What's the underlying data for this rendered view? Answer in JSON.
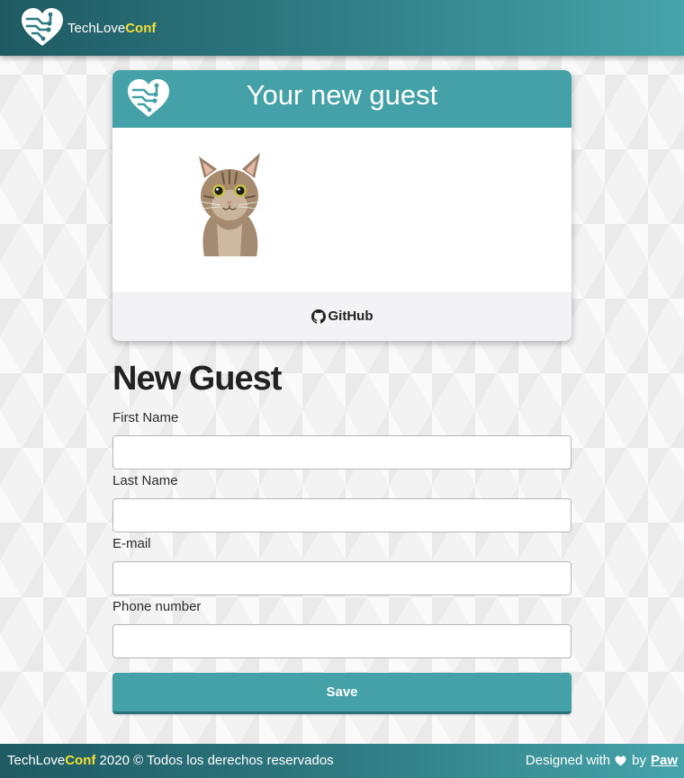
{
  "header": {
    "brand_primary": "TechLove",
    "brand_accent": "Conf",
    "logo_icon": "heart-circuit-logo"
  },
  "badge": {
    "title": "Your new guest",
    "avatar_icon": "cat-photo",
    "github_label": "GitHub",
    "github_icon": "github-icon"
  },
  "form": {
    "title": "New Guest",
    "fields": [
      {
        "label": "First Name",
        "value": "",
        "placeholder": ""
      },
      {
        "label": "Last Name",
        "value": "",
        "placeholder": ""
      },
      {
        "label": "E-mail",
        "value": "",
        "placeholder": ""
      },
      {
        "label": "Phone number",
        "value": "",
        "placeholder": ""
      }
    ],
    "save_label": "Save"
  },
  "footer": {
    "brand_primary": "TechLove",
    "brand_accent": "Conf",
    "year": "2020",
    "rights": "© Todos los derechos reservados",
    "designed_with": "Designed with",
    "by": "by",
    "author": "Paw",
    "heart_icon": "heart-icon"
  },
  "colors": {
    "accent": "#43a1a7",
    "brand_yellow": "#f3e135",
    "header_dark": "#1f5a62"
  }
}
